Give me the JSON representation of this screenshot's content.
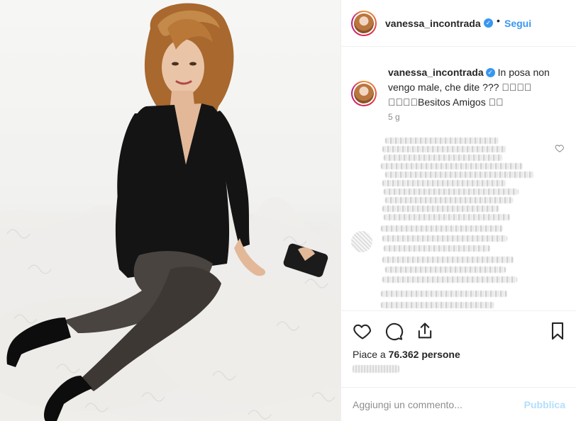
{
  "post": {
    "username": "vanessa_incontrada",
    "follow_label": "Segui",
    "separator": "•",
    "more_label": "···",
    "verified_glyph": "✓",
    "caption_line": "In posa non vengo male, che dite ??? ￿￿￿￿ ￿￿￿￿Besitos Amigos ￿￿",
    "time_ago": "5 g",
    "likes_prefix": "Piace a",
    "likes_count": "76.362",
    "likes_suffix": "persone",
    "comment_placeholder": "Aggiungi un commento...",
    "publish_label": "Pubblica"
  },
  "icons": {
    "like": "heart-icon",
    "comment": "comment-bubble-icon",
    "share": "share-icon",
    "save": "bookmark-icon"
  },
  "colors": {
    "accent": "#3897f0",
    "publish_disabled": "#b2dffc",
    "muted": "#8e8e8e",
    "text": "#262626",
    "border": "#efefef"
  }
}
